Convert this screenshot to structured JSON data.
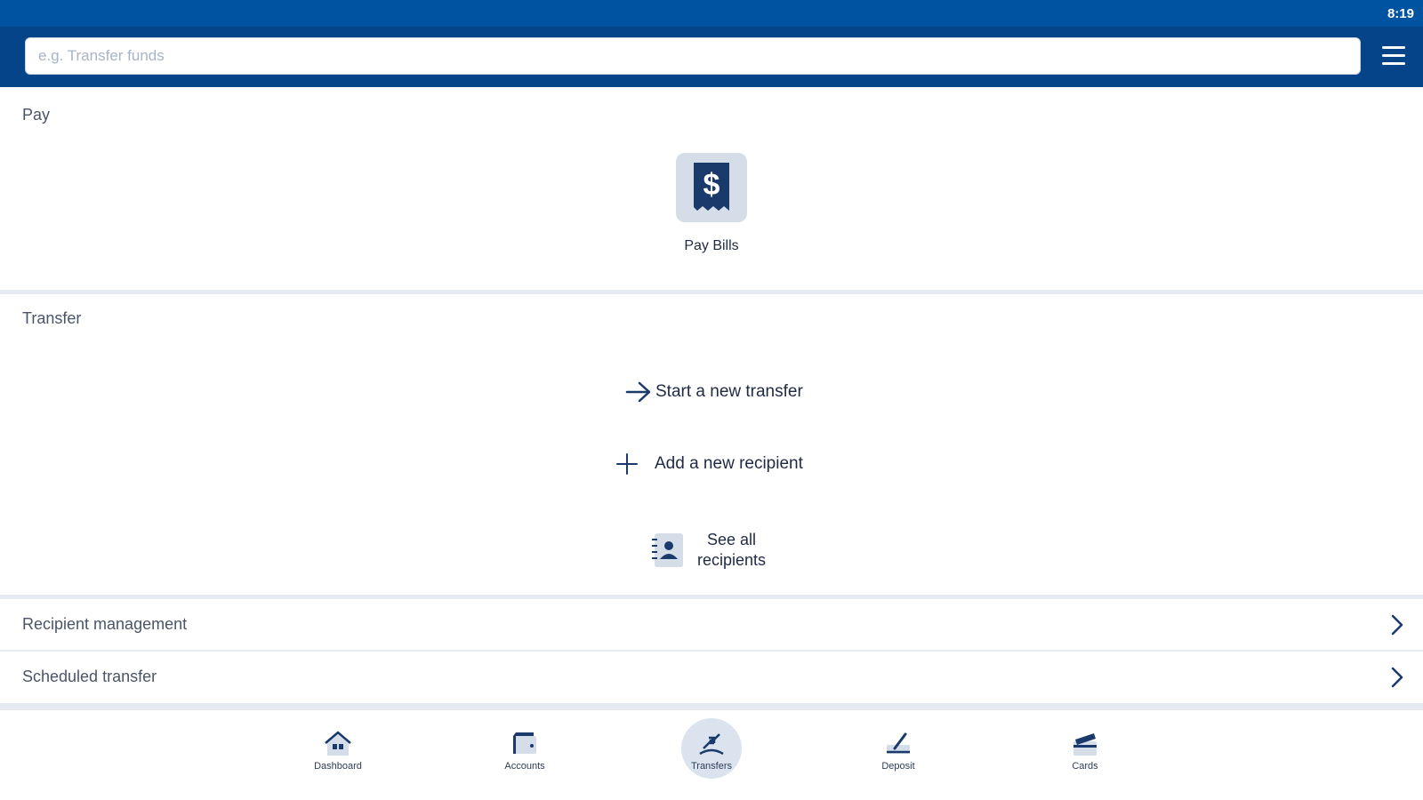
{
  "status_bar": {
    "time": "8:19"
  },
  "search": {
    "placeholder": "e.g. Transfer funds",
    "value": ""
  },
  "sections": {
    "pay": "Pay",
    "transfer": "Transfer"
  },
  "pay": {
    "pay_bills_label": "Pay Bills"
  },
  "transfer": {
    "start_new_transfer": "Start a new transfer",
    "add_new_recipient": "Add a new recipient",
    "see_all_recipients_line1": "See all",
    "see_all_recipients_line2": "recipients"
  },
  "rows": [
    {
      "label": "Recipient management"
    },
    {
      "label": "Scheduled transfer"
    }
  ],
  "bottom_nav": [
    {
      "label": "Dashboard",
      "icon": "home-icon"
    },
    {
      "label": "Accounts",
      "icon": "wallet-icon"
    },
    {
      "label": "Transfers",
      "icon": "transfer-icon",
      "active": true
    },
    {
      "label": "Deposit",
      "icon": "check-deposit-icon"
    },
    {
      "label": "Cards",
      "icon": "card-icon"
    }
  ],
  "colors": {
    "status_bar": "#0053a0",
    "top_bar": "#054489",
    "icon_primary": "#1a3a6c",
    "tile_background": "#d4dde8",
    "divider": "#e6ebf1"
  }
}
